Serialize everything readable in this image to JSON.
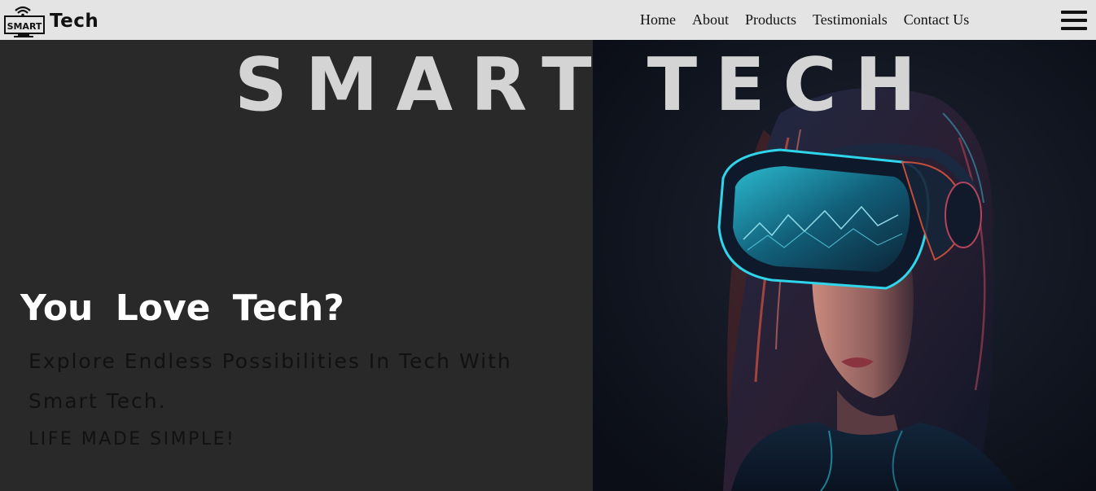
{
  "brand": {
    "badge_text": "SMART",
    "name": "Tech"
  },
  "nav": {
    "items": [
      "Home",
      "About",
      "Products",
      "Testimonials",
      "Contact Us"
    ]
  },
  "hero": {
    "title_word1": "SMART",
    "title_word2": "TECH",
    "headline": "You Love Tech?",
    "subtext": "Explore Endless Possibilities In Tech With Smart Tech.",
    "tagline": "LIFE MADE SIMPLE!"
  },
  "colors": {
    "navbar_bg": "#e4e4e4",
    "left_bg": "#292929",
    "title": "#d4d4d4",
    "accent_cyan": "#27c6e0",
    "accent_red": "#d5533f"
  }
}
